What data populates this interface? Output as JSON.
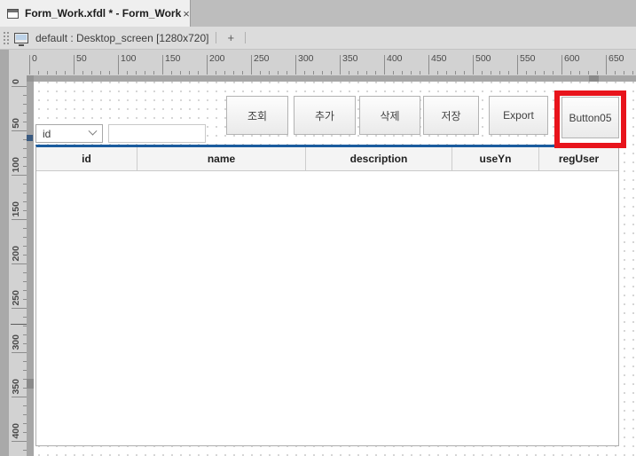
{
  "window": {
    "tab": {
      "title": "Form_Work.xfdl * - Form_Work",
      "close": "×"
    },
    "screen_bar": {
      "label": "default : Desktop_screen [1280x720]",
      "add": "+"
    }
  },
  "rulers": {
    "horizontal": {
      "minor_step": 10,
      "major_step": 50,
      "max": 680,
      "labels": [
        0,
        50,
        100,
        150,
        200,
        250,
        300,
        350,
        400,
        450,
        500,
        550,
        600,
        650
      ]
    },
    "vertical": {
      "minor_step": 10,
      "major_step": 50,
      "max": 410,
      "labels": [
        0,
        50,
        100,
        150,
        200,
        250,
        300,
        350,
        400
      ]
    }
  },
  "form": {
    "search_combo": {
      "value": "id"
    },
    "search_input": {
      "value": ""
    },
    "buttons": [
      {
        "label": "조회"
      },
      {
        "label": "추가"
      },
      {
        "label": "삭제"
      },
      {
        "label": "저장"
      },
      {
        "label": "Export"
      },
      {
        "label": "Button05",
        "highlighted": true
      }
    ],
    "grid": {
      "columns": [
        "id",
        "name",
        "description",
        "useYn",
        "regUser"
      ],
      "rows": []
    }
  },
  "colors": {
    "accent_blue": "#1b5c9e",
    "highlight_red": "#e8141c"
  }
}
